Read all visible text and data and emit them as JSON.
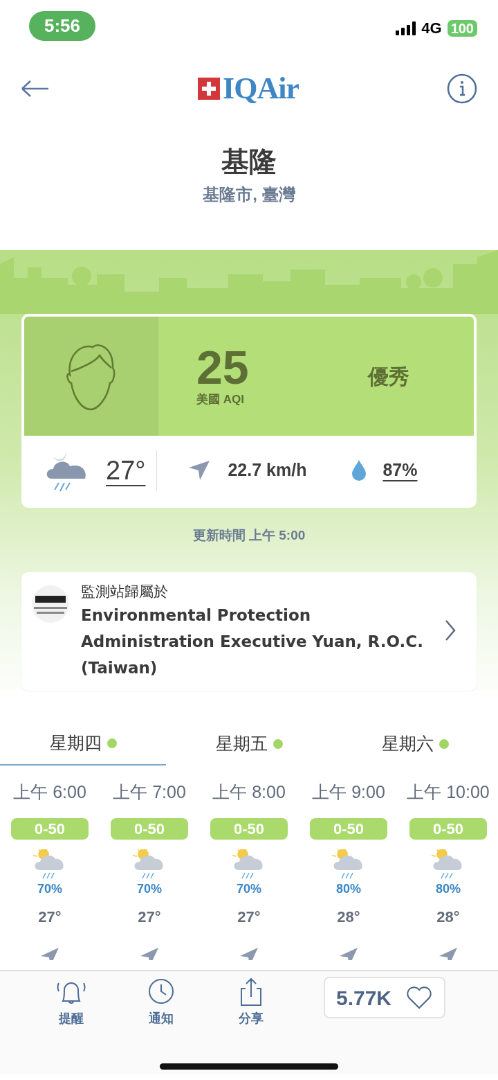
{
  "status_bar": {
    "time": "5:56",
    "network": "4G",
    "battery": "100"
  },
  "header": {
    "brand": "IQAir"
  },
  "location": {
    "city": "基隆",
    "region": "基隆市, 臺灣"
  },
  "aqi_card": {
    "value": "25",
    "unit": "美國 AQI",
    "category": "優秀",
    "color": "#b3de78",
    "temperature": "27°",
    "wind": "22.7 km/h",
    "humidity": "87%"
  },
  "updated": "更新時間 上午 5:00",
  "station": {
    "label": "監測站歸屬於",
    "owner": "Environmental Protection Administration Executive Yuan, R.O.C. (Taiwan)"
  },
  "days": [
    {
      "label": "星期四",
      "selected": true,
      "color": "#a3d765"
    },
    {
      "label": "星期五",
      "selected": false,
      "color": "#a3d765"
    },
    {
      "label": "星期六",
      "selected": false,
      "color": "#a3d765"
    }
  ],
  "hours": [
    {
      "time": "上午 6:00",
      "aqi": "0-50",
      "color": "#a9da6b",
      "rain": "70%",
      "temp": "27°"
    },
    {
      "time": "上午 7:00",
      "aqi": "0-50",
      "color": "#a9da6b",
      "rain": "70%",
      "temp": "27°"
    },
    {
      "time": "上午 8:00",
      "aqi": "0-50",
      "color": "#a9da6b",
      "rain": "70%",
      "temp": "27°"
    },
    {
      "time": "上午 9:00",
      "aqi": "0-50",
      "color": "#a9da6b",
      "rain": "80%",
      "temp": "28°"
    },
    {
      "time": "上午 10:00",
      "aqi": "0-50",
      "color": "#a9da6b",
      "rain": "80%",
      "temp": "28°"
    }
  ],
  "bottom_bar": {
    "items": [
      {
        "label": "提醒",
        "kind": "bell"
      },
      {
        "label": "通知",
        "kind": "clock"
      },
      {
        "label": "分享",
        "kind": "share"
      }
    ],
    "likes": "5.77K"
  }
}
